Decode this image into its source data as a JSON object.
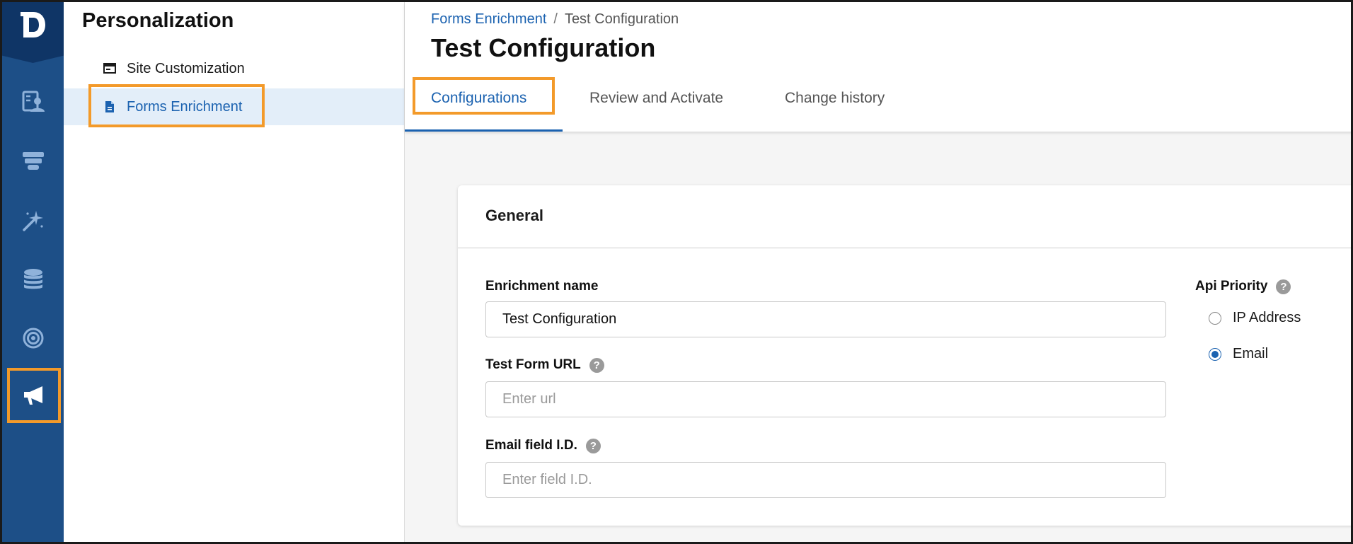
{
  "rail": {
    "items": [
      {
        "icon": "contacts-icon"
      },
      {
        "icon": "funnel-icon"
      },
      {
        "icon": "magic-wand-icon"
      },
      {
        "icon": "database-icon"
      },
      {
        "icon": "target-icon"
      },
      {
        "icon": "megaphone-icon",
        "active": true
      }
    ],
    "logo": "D"
  },
  "sidebar": {
    "title": "Personalization",
    "items": [
      {
        "label": "Site Customization",
        "icon": "browser-window-icon"
      },
      {
        "label": "Forms Enrichment",
        "icon": "document-icon",
        "selected": true
      }
    ]
  },
  "header": {
    "breadcrumb": {
      "parent": "Forms Enrichment",
      "separator": "/",
      "current": "Test Configuration"
    },
    "title": "Test Configuration",
    "tabs": [
      {
        "label": "Configurations",
        "active": true
      },
      {
        "label": "Review and Activate"
      },
      {
        "label": "Change history"
      }
    ]
  },
  "general": {
    "title": "General",
    "enrichment_name": {
      "label": "Enrichment name",
      "value": "Test Configuration"
    },
    "test_form_url": {
      "label": "Test Form URL",
      "placeholder": "Enter url",
      "help": "?"
    },
    "email_field_id": {
      "label": "Email field I.D.",
      "placeholder": "Enter field I.D.",
      "help": "?"
    },
    "api_priority": {
      "label": "Api Priority",
      "help": "?",
      "options": [
        {
          "label": "IP Address",
          "selected": false
        },
        {
          "label": "Email",
          "selected": true
        }
      ]
    }
  },
  "colors": {
    "rail": "#1d4f87",
    "accent": "#1b62b0",
    "highlight": "#f39a2a",
    "selected_bg": "#e3eef9"
  }
}
